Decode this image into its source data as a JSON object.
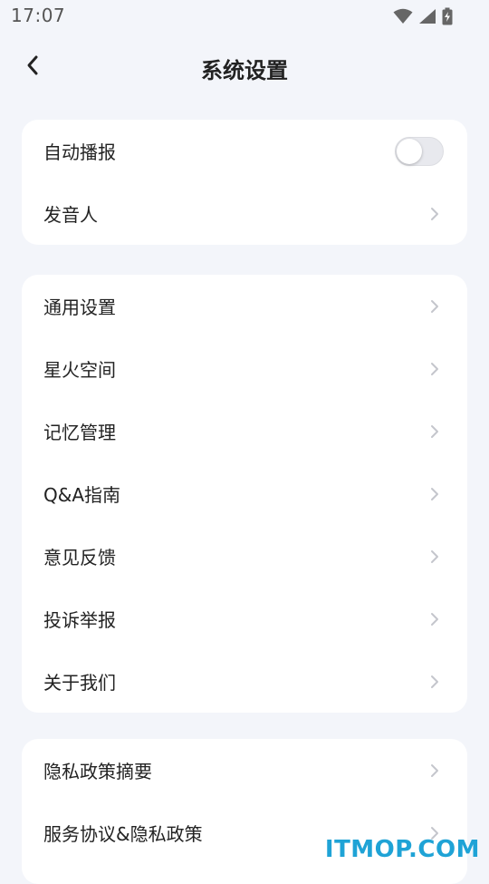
{
  "status_bar": {
    "time": "17:07"
  },
  "header": {
    "title": "系统设置"
  },
  "card1": {
    "items": [
      {
        "label": "自动播报",
        "type": "toggle",
        "on": false
      },
      {
        "label": "发音人",
        "type": "link"
      }
    ]
  },
  "card2": {
    "items": [
      {
        "label": "通用设置"
      },
      {
        "label": "星火空间"
      },
      {
        "label": "记忆管理"
      },
      {
        "label": "Q&A指南"
      },
      {
        "label": "意见反馈"
      },
      {
        "label": "投诉举报"
      },
      {
        "label": "关于我们"
      }
    ]
  },
  "card3": {
    "items": [
      {
        "label": "隐私政策摘要"
      },
      {
        "label": "服务协议&隐私政策"
      }
    ]
  },
  "watermark": "ITMOP.COM",
  "colors": {
    "background": "#f3f5fa",
    "card": "#ffffff",
    "chevron": "#c4c6cc",
    "watermark": "#1fa3d6"
  }
}
